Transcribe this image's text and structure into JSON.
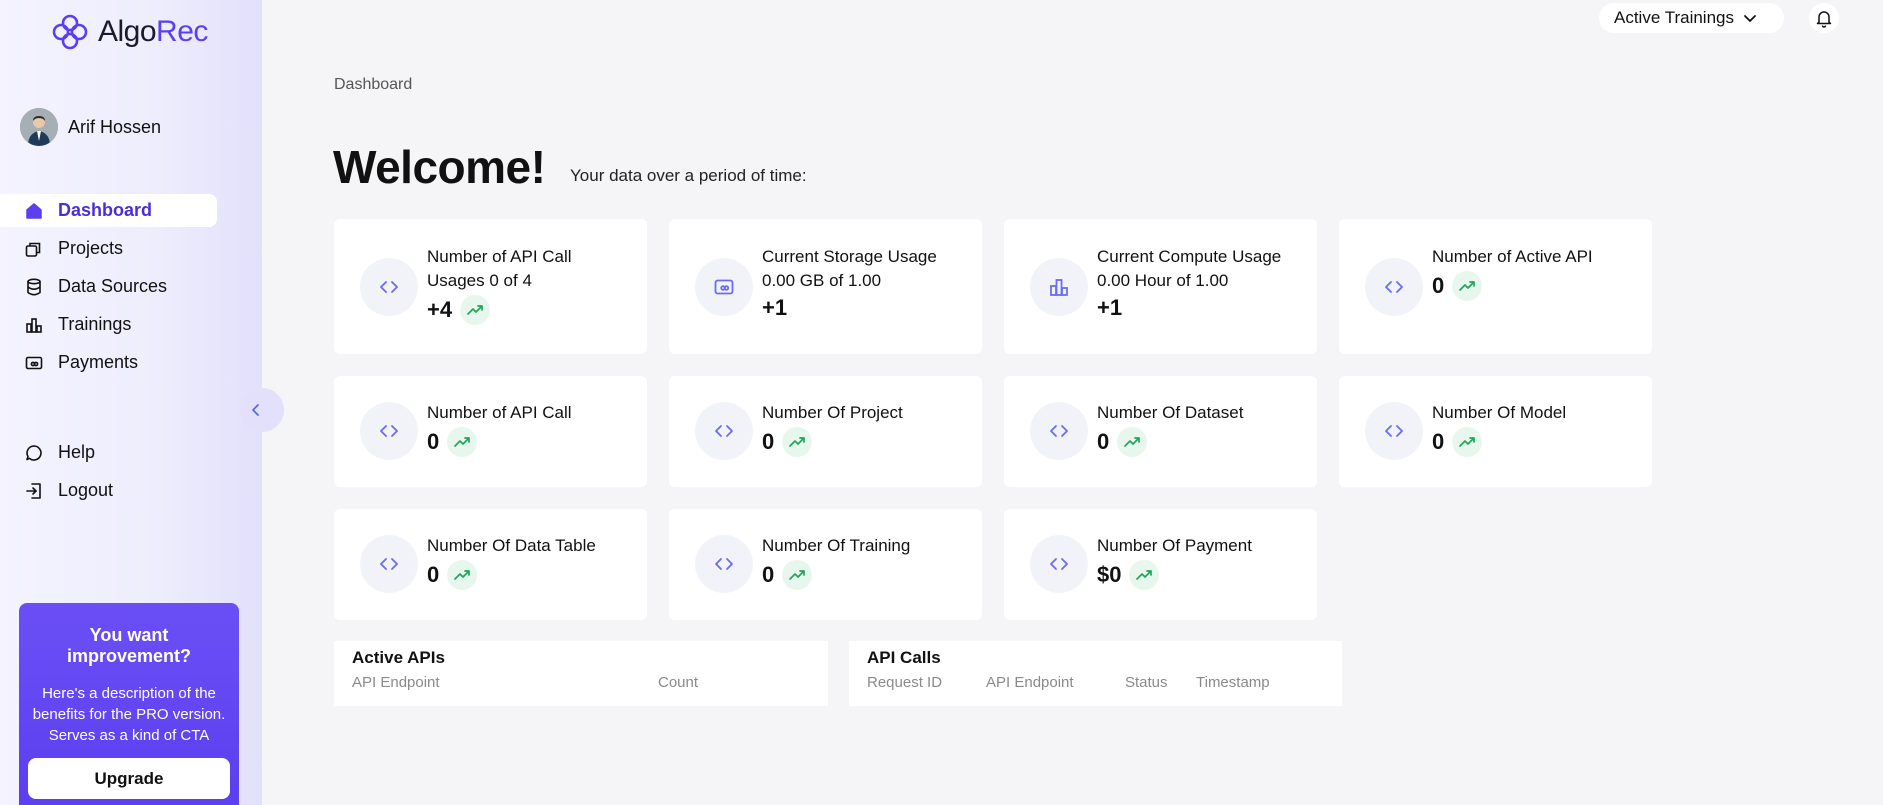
{
  "brand": {
    "name_part1": "Algo",
    "name_part2": "Rec"
  },
  "user": {
    "name": "Arif Hossen"
  },
  "sidebar": {
    "items": [
      {
        "label": "Dashboard",
        "icon": "home-icon",
        "active": true
      },
      {
        "label": "Projects",
        "icon": "projects-icon"
      },
      {
        "label": "Data Sources",
        "icon": "database-icon"
      },
      {
        "label": "Trainings",
        "icon": "bar-chart-icon"
      },
      {
        "label": "Payments",
        "icon": "payment-icon"
      }
    ],
    "bottom_items": [
      {
        "label": "Help",
        "icon": "chat-bubble-icon"
      },
      {
        "label": "Logout",
        "icon": "logout-icon"
      }
    ]
  },
  "promo": {
    "title": "You want improvement?",
    "description": "Here's a description of the benefits for the PRO version. Serves as a kind of CTA",
    "button_label": "Upgrade"
  },
  "topbar": {
    "select_label": "Active Trainings"
  },
  "breadcrumb": "Dashboard",
  "welcome": {
    "title": "Welcome!",
    "subtitle": "Your data over a period of time:"
  },
  "cards": [
    {
      "label_line1": "Number of API Call",
      "label_line2": "Usages 0 of 4",
      "value": "+4",
      "icon": "code-icon",
      "trend": true
    },
    {
      "label_line1": "Current Storage Usage",
      "label_line2": "0.00 GB of 1.00",
      "value": "+1",
      "icon": "storage-icon",
      "trend": false
    },
    {
      "label_line1": "Current Compute Usage",
      "label_line2": "0.00 Hour of 1.00",
      "value": "+1",
      "icon": "bar-chart-icon",
      "trend": false
    },
    {
      "label_line1": "Number of Active API",
      "value": "0",
      "icon": "code-icon",
      "trend": true
    },
    {
      "label_line1": "Number of API Call",
      "value": "0",
      "icon": "code-icon",
      "trend": true
    },
    {
      "label_line1": "Number Of Project",
      "value": "0",
      "icon": "code-icon",
      "trend": true
    },
    {
      "label_line1": "Number Of Dataset",
      "value": "0",
      "icon": "code-icon",
      "trend": true
    },
    {
      "label_line1": "Number Of Model",
      "value": "0",
      "icon": "code-icon",
      "trend": true
    },
    {
      "label_line1": "Number Of Data Table",
      "value": "0",
      "icon": "code-icon",
      "trend": true
    },
    {
      "label_line1": "Number Of Training",
      "value": "0",
      "icon": "code-icon",
      "trend": true
    },
    {
      "label_line1": "Number Of Payment",
      "value": "$0",
      "icon": "code-icon",
      "trend": true
    }
  ],
  "active_apis": {
    "title": "Active APIs",
    "columns": [
      "API Endpoint",
      "Count"
    ]
  },
  "api_calls": {
    "title": "API Calls",
    "columns": [
      "Request ID",
      "API Endpoint",
      "Status",
      "Timestamp"
    ]
  },
  "colors": {
    "accent": "#5b3ff0",
    "trend_green": "#22a559",
    "icon_blue": "#6c6cf2"
  }
}
